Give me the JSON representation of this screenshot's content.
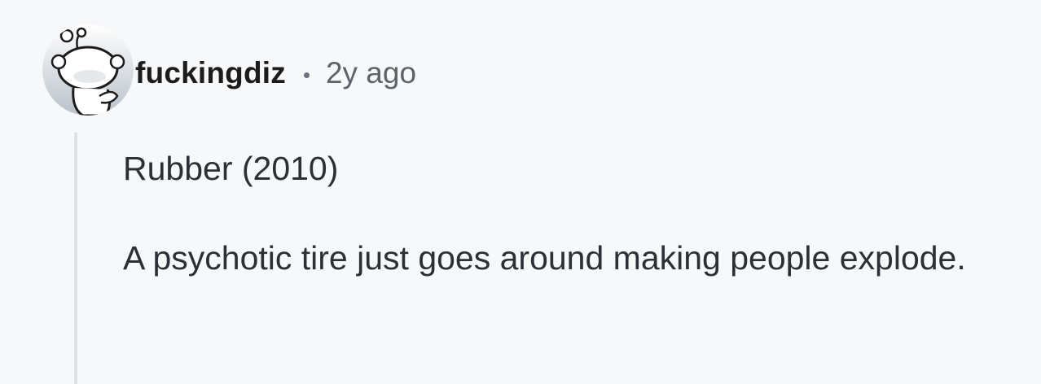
{
  "comment": {
    "author": "fuckingdiz",
    "separator": "·",
    "timestamp": "2y ago",
    "avatar_icon": "snoo-avatar-icon",
    "body": {
      "paragraphs": [
        "Rubber (2010)",
        "A psychotic tire just goes around making people explode."
      ]
    }
  },
  "colors": {
    "background": "#f7f8fa",
    "author_text": "#1c1c1c",
    "meta_text": "#5b636b",
    "body_text": "#2b3036",
    "thread_line": "#dde2e8"
  }
}
